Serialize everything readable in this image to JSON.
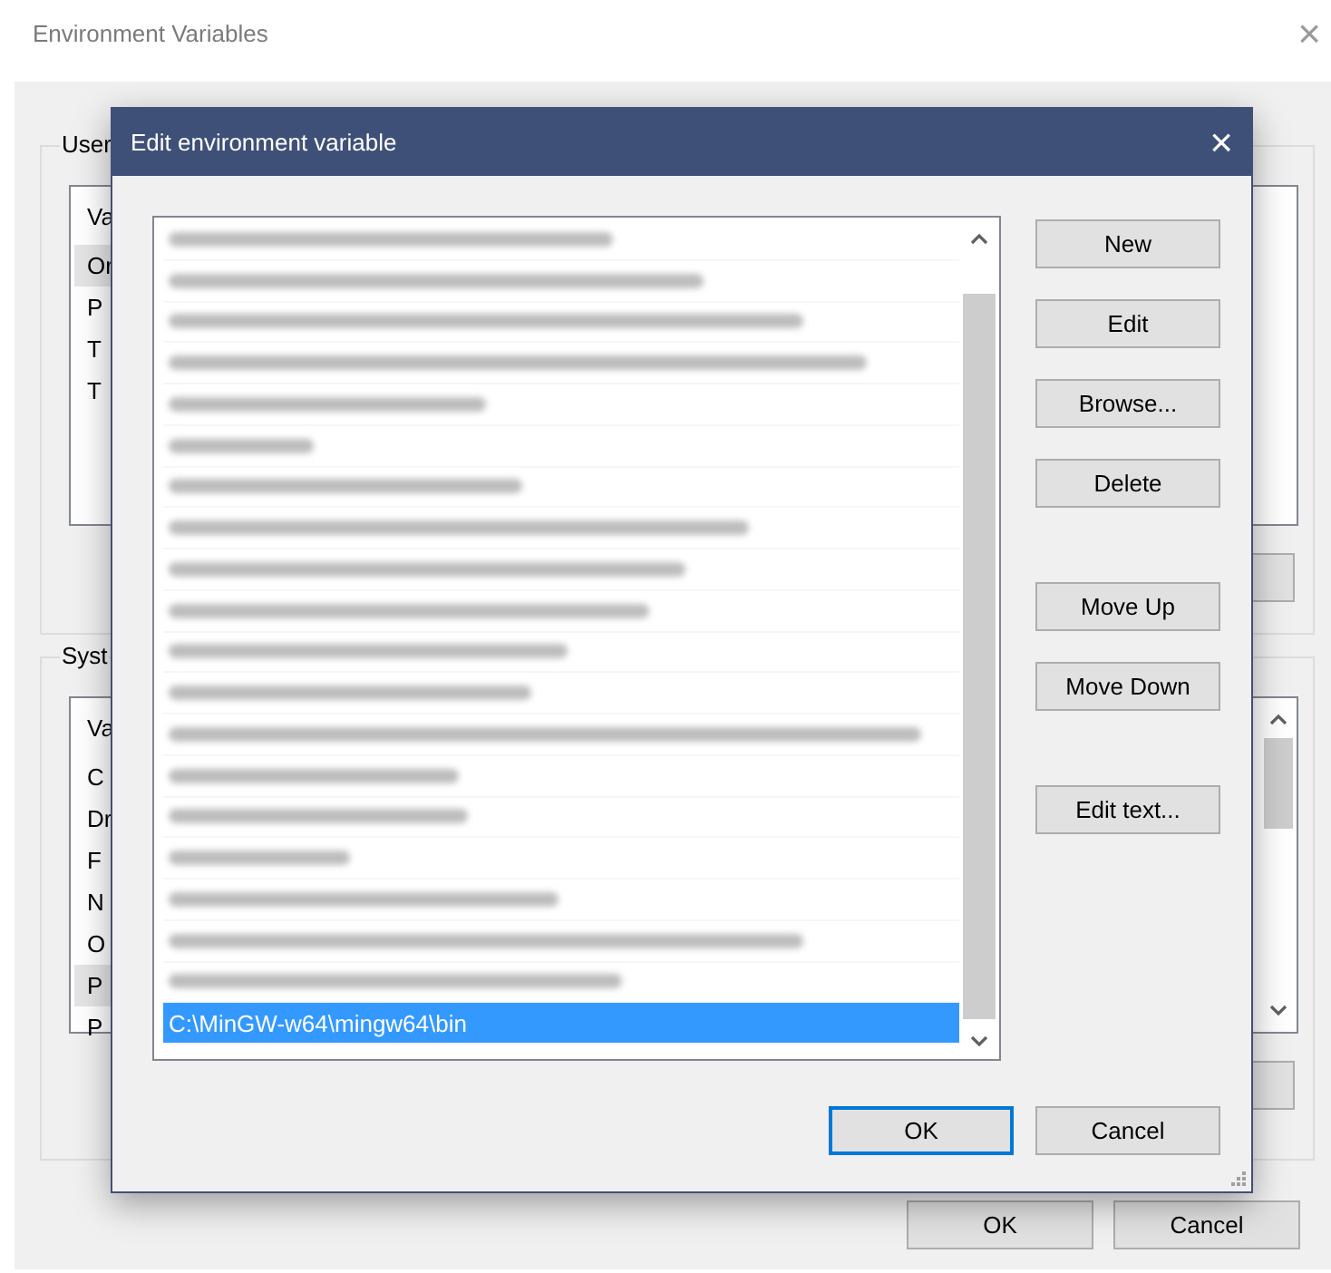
{
  "background_window": {
    "title": "Environment Variables",
    "close": "×",
    "user_group": {
      "label": "User",
      "column_header": "Va",
      "rows": [
        {
          "text": "Or",
          "selected": true
        },
        {
          "text": "P",
          "selected": false
        },
        {
          "text": "T",
          "selected": false
        },
        {
          "text": "T",
          "selected": false
        }
      ]
    },
    "system_group": {
      "label": "Syst",
      "column_header": "Va",
      "rows": [
        {
          "text": "C",
          "selected": false
        },
        {
          "text": "Dr",
          "selected": false
        },
        {
          "text": "F",
          "selected": false
        },
        {
          "text": "N",
          "selected": false
        },
        {
          "text": "O",
          "selected": false
        },
        {
          "text": "P",
          "selected": true
        },
        {
          "text": "P",
          "selected": false
        }
      ]
    },
    "buttons": [
      {
        "label": "OK"
      },
      {
        "label": "Cancel"
      }
    ]
  },
  "dialog": {
    "title": "Edit environment variable",
    "close": "×",
    "entries": [
      {
        "kind": "blurred",
        "selected": false
      },
      {
        "kind": "blurred",
        "selected": false
      },
      {
        "kind": "blurred",
        "selected": false
      },
      {
        "kind": "blurred",
        "selected": false
      },
      {
        "kind": "blurred",
        "selected": false
      },
      {
        "kind": "blurred",
        "selected": false
      },
      {
        "kind": "blurred",
        "selected": false
      },
      {
        "kind": "blurred",
        "selected": false
      },
      {
        "kind": "blurred",
        "selected": false
      },
      {
        "kind": "blurred",
        "selected": false
      },
      {
        "kind": "blurred",
        "selected": false
      },
      {
        "kind": "blurred",
        "selected": false
      },
      {
        "kind": "blurred",
        "selected": false
      },
      {
        "kind": "blurred",
        "selected": false
      },
      {
        "kind": "blurred",
        "selected": false
      },
      {
        "kind": "blurred",
        "selected": false
      },
      {
        "kind": "blurred",
        "selected": false
      },
      {
        "kind": "blurred",
        "selected": false
      },
      {
        "kind": "blurred",
        "selected": false
      },
      {
        "kind": "text",
        "text": "C:\\MinGW-w64\\mingw64\\bin",
        "selected": true
      }
    ],
    "side_buttons": [
      [
        "New",
        "Edit",
        "Browse...",
        "Delete"
      ],
      [
        "Move Up",
        "Move Down"
      ],
      [
        "Edit text..."
      ]
    ],
    "footer_buttons": [
      {
        "label": "OK",
        "default": true
      },
      {
        "label": "Cancel",
        "default": false
      }
    ]
  }
}
